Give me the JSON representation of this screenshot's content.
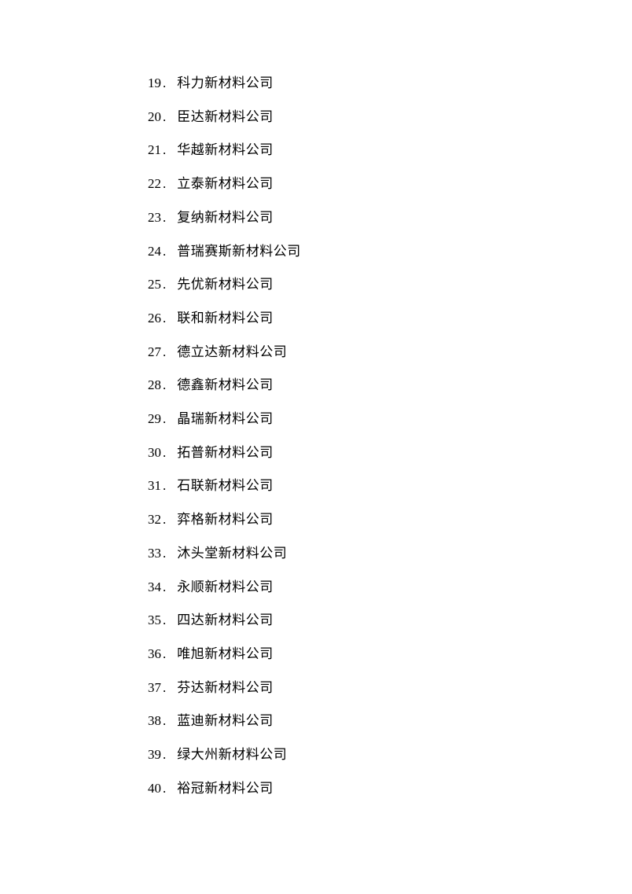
{
  "items": [
    {
      "num": "19",
      "text": "科力新材料公司"
    },
    {
      "num": "20",
      "text": "臣达新材料公司"
    },
    {
      "num": "21",
      "text": "华越新材料公司"
    },
    {
      "num": "22",
      "text": "立泰新材料公司"
    },
    {
      "num": "23",
      "text": "复纳新材料公司"
    },
    {
      "num": "24",
      "text": "普瑞赛斯新材料公司"
    },
    {
      "num": "25",
      "text": "先优新材料公司"
    },
    {
      "num": "26",
      "text": "联和新材料公司"
    },
    {
      "num": "27",
      "text": "德立达新材料公司"
    },
    {
      "num": "28",
      "text": "德鑫新材料公司"
    },
    {
      "num": "29",
      "text": "晶瑞新材料公司"
    },
    {
      "num": "30",
      "text": "拓普新材料公司"
    },
    {
      "num": "31",
      "text": "石联新材料公司"
    },
    {
      "num": "32",
      "text": "弈格新材料公司"
    },
    {
      "num": "33",
      "text": "沐头堂新材料公司"
    },
    {
      "num": "34",
      "text": "永顺新材料公司"
    },
    {
      "num": "35",
      "text": "四达新材料公司"
    },
    {
      "num": "36",
      "text": "唯旭新材料公司"
    },
    {
      "num": "37",
      "text": "芬达新材料公司"
    },
    {
      "num": "38",
      "text": "蓝迪新材料公司"
    },
    {
      "num": "39",
      "text": "绿大州新材料公司"
    },
    {
      "num": "40",
      "text": "裕冠新材料公司"
    }
  ]
}
